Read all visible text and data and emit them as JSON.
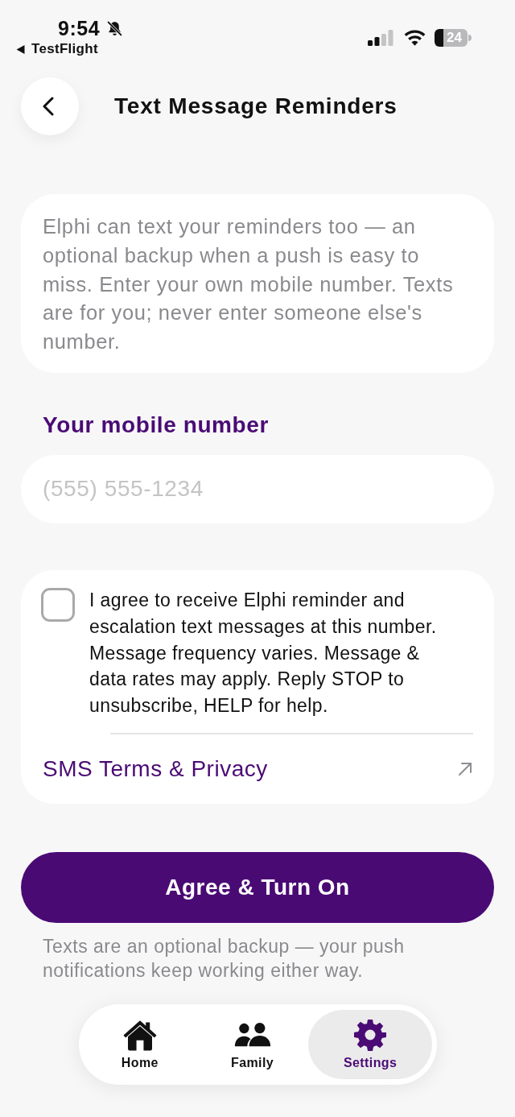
{
  "status_bar": {
    "time": "9:54",
    "back_app": "TestFlight",
    "battery": "24"
  },
  "header": {
    "title": "Text Message Reminders"
  },
  "intro": {
    "text": "Elphi can text your reminders too — an optional backup when a push is easy to miss. Enter your own mobile number. Texts are for you; never enter someone else's number."
  },
  "phone_field": {
    "label": "Your mobile number",
    "placeholder": "(555) 555-1234"
  },
  "consent": {
    "checked": false,
    "text": "I agree to receive Elphi reminder and escalation text messages at this number. Message frequency varies. Message & data rates may apply. Reply STOP to unsubscribe, HELP for help.",
    "link": "SMS Terms & Privacy"
  },
  "primary_button": {
    "label": "Agree & Turn On"
  },
  "footnote": "Texts are an optional backup — your push notifications keep working either way.",
  "tab_bar": {
    "items": [
      {
        "kind": "home",
        "label": "Home",
        "selected": false
      },
      {
        "kind": "family",
        "label": "Family",
        "selected": false
      },
      {
        "kind": "settings",
        "label": "Settings",
        "selected": true
      }
    ]
  }
}
